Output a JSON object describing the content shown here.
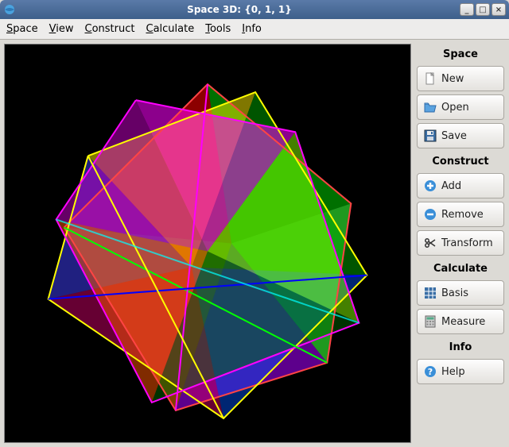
{
  "window": {
    "title": "Space 3D: {0, 1, 1}",
    "controls": {
      "minimize": "_",
      "maximize": "□",
      "close": "×"
    }
  },
  "menubar": {
    "items": [
      "Space",
      "View",
      "Construct",
      "Calculate",
      "Tools",
      "Info"
    ]
  },
  "sidebar": {
    "sections": [
      {
        "title": "Space",
        "buttons": [
          {
            "id": "new",
            "label": "New",
            "icon": "file-new-icon"
          },
          {
            "id": "open",
            "label": "Open",
            "icon": "folder-open-icon"
          },
          {
            "id": "save",
            "label": "Save",
            "icon": "floppy-save-icon"
          }
        ]
      },
      {
        "title": "Construct",
        "buttons": [
          {
            "id": "add",
            "label": "Add",
            "icon": "plus-circle-icon"
          },
          {
            "id": "remove",
            "label": "Remove",
            "icon": "minus-circle-icon"
          },
          {
            "id": "transform",
            "label": "Transform",
            "icon": "scissors-icon"
          }
        ]
      },
      {
        "title": "Calculate",
        "buttons": [
          {
            "id": "basis",
            "label": "Basis",
            "icon": "grid-blue-icon"
          },
          {
            "id": "measure",
            "label": "Measure",
            "icon": "calculator-icon"
          }
        ]
      },
      {
        "title": "Info",
        "buttons": [
          {
            "id": "help",
            "label": "Help",
            "icon": "help-icon"
          }
        ]
      }
    ]
  },
  "viewport": {
    "object": "compound-polyhedra",
    "background": "#000000",
    "face_colors": [
      "#ff0000",
      "#00ff00",
      "#0000ff",
      "#ffff00",
      "#ff00ff",
      "#ff8000",
      "#8000ff"
    ]
  }
}
